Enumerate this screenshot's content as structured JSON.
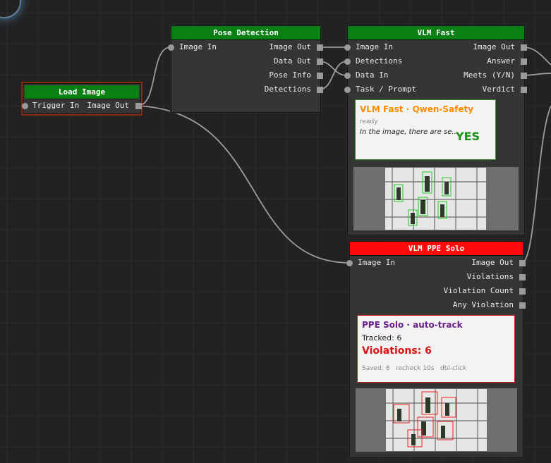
{
  "nodes": {
    "load_image": {
      "title": "Load Image",
      "inputs": [
        "Trigger In"
      ],
      "outputs": [
        "Image Out"
      ]
    },
    "pose_detection": {
      "title": "Pose Detection",
      "inputs": [
        "Image In"
      ],
      "outputs": [
        "Image Out",
        "Data Out",
        "Pose Info",
        "Detections"
      ]
    },
    "vlm_fast": {
      "title": "VLM Fast",
      "inputs": [
        "Image In",
        "Detections",
        "Data In",
        "Task / Prompt"
      ],
      "outputs": [
        "Image Out",
        "Answer",
        "Meets (Y/N)",
        "Verdict"
      ],
      "panel": {
        "heading": "VLM Fast · Qwen-Safety",
        "status": "ready",
        "answer_text": "In the image, there are se...",
        "verdict": "YES"
      }
    },
    "vlm_ppe_solo": {
      "title": "VLM PPE Solo",
      "inputs": [
        "Image In"
      ],
      "outputs": [
        "Image Out",
        "Violations",
        "Violation Count",
        "Any Violation"
      ],
      "panel": {
        "heading": "PPE Solo · auto-track",
        "tracked": "Tracked: 6",
        "violations": "Violations: 6",
        "footer": "Saved: 8   recheck 10s   dbl-click"
      }
    }
  },
  "colors": {
    "title_green": "#0a7f14",
    "title_red": "#ff0a0a",
    "fast_heading": "#ff8c00",
    "verdict_yes": "#1a8f1a",
    "ppe_heading": "#6a1f8a",
    "violation_red": "#e01010"
  }
}
